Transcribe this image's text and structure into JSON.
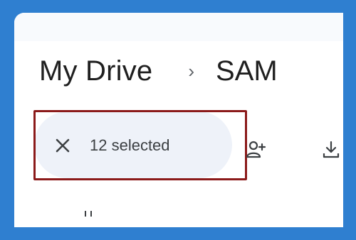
{
  "breadcrumb": {
    "root": "My Drive",
    "separator": "›",
    "current": "SAM"
  },
  "selection": {
    "count_label": "12 selected"
  },
  "icons": {
    "close": "close-icon",
    "share": "person-add-icon",
    "download": "download-icon"
  },
  "colors": {
    "background": "#2f7fd0",
    "pill": "#eef2f9",
    "highlight": "#8b1a1a"
  }
}
